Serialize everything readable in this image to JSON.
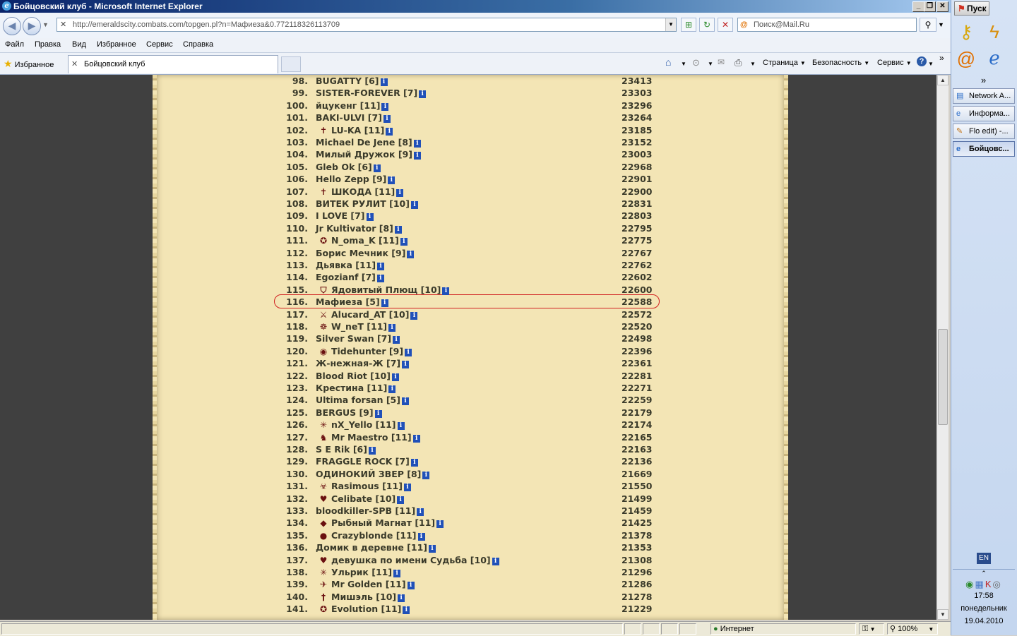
{
  "window": {
    "title": "Бойцовский клуб - Microsoft Internet Explorer",
    "controls": [
      "_",
      "❐",
      "✕"
    ]
  },
  "address_bar": {
    "url": "http://emeraldscity.combats.com/topgen.pl?n=Мафиеза&0.772118326113709"
  },
  "search": {
    "placeholder": "Поиск@Mail.Ru"
  },
  "menu": [
    "Файл",
    "Правка",
    "Вид",
    "Избранное",
    "Сервис",
    "Справка"
  ],
  "favorites_bar": {
    "favorites_label": "Избранное",
    "tab_title": "Бойцовский клуб"
  },
  "command_bar": {
    "page": "Страница",
    "safety": "Безопасность",
    "tools": "Сервис"
  },
  "ranking": [
    {
      "rank": "98.",
      "name": "BUGATTY [6]",
      "score": "23413",
      "emblem": ""
    },
    {
      "rank": "99.",
      "name": "SISTER-FOREVER [7]",
      "score": "23303",
      "emblem": ""
    },
    {
      "rank": "100.",
      "name": "йцукенг [11]",
      "score": "23296",
      "emblem": ""
    },
    {
      "rank": "101.",
      "name": "BAKI-ULVI [7]",
      "score": "23264",
      "emblem": ""
    },
    {
      "rank": "102.",
      "name": "LU-KA [11]",
      "score": "23185",
      "emblem": "✝"
    },
    {
      "rank": "103.",
      "name": "Michael De Jene [8]",
      "score": "23152",
      "emblem": ""
    },
    {
      "rank": "104.",
      "name": "Милый Дружок [9]",
      "score": "23003",
      "emblem": ""
    },
    {
      "rank": "105.",
      "name": "Gleb Ok [6]",
      "score": "22968",
      "emblem": ""
    },
    {
      "rank": "106.",
      "name": "Hello Zepp [9]",
      "score": "22901",
      "emblem": ""
    },
    {
      "rank": "107.",
      "name": "ШКОДА [11]",
      "score": "22900",
      "emblem": "✝"
    },
    {
      "rank": "108.",
      "name": "ВИТЕК РУЛИТ [10]",
      "score": "22831",
      "emblem": ""
    },
    {
      "rank": "109.",
      "name": "I LOVE [7]",
      "score": "22803",
      "emblem": ""
    },
    {
      "rank": "110.",
      "name": "Jr Kultivator [8]",
      "score": "22795",
      "emblem": ""
    },
    {
      "rank": "111.",
      "name": "N_oma_K [11]",
      "score": "22775",
      "emblem": "✪"
    },
    {
      "rank": "112.",
      "name": "Борис Мечник [9]",
      "score": "22767",
      "emblem": ""
    },
    {
      "rank": "113.",
      "name": "Дьявка [11]",
      "score": "22762",
      "emblem": ""
    },
    {
      "rank": "114.",
      "name": "Egozianf [7]",
      "score": "22602",
      "emblem": ""
    },
    {
      "rank": "115.",
      "name": "Ядовитый Плющ [10]",
      "score": "22600",
      "emblem": "⛉"
    },
    {
      "rank": "116.",
      "name": "Мафиеза [5]",
      "score": "22588",
      "emblem": ""
    },
    {
      "rank": "117.",
      "name": "Alucard_AT [10]",
      "score": "22572",
      "emblem": "⚔"
    },
    {
      "rank": "118.",
      "name": "W_neT [11]",
      "score": "22520",
      "emblem": "☸"
    },
    {
      "rank": "119.",
      "name": "Silver Swan [7]",
      "score": "22498",
      "emblem": ""
    },
    {
      "rank": "120.",
      "name": "Tidehunter [9]",
      "score": "22396",
      "emblem": "◉"
    },
    {
      "rank": "121.",
      "name": "Ж-нежная-Ж [7]",
      "score": "22361",
      "emblem": ""
    },
    {
      "rank": "122.",
      "name": "Blood Riot [10]",
      "score": "22281",
      "emblem": ""
    },
    {
      "rank": "123.",
      "name": "Крестина [11]",
      "score": "22271",
      "emblem": ""
    },
    {
      "rank": "124.",
      "name": "Ultima forsan [5]",
      "score": "22259",
      "emblem": ""
    },
    {
      "rank": "125.",
      "name": "BERGUS [9]",
      "score": "22179",
      "emblem": ""
    },
    {
      "rank": "126.",
      "name": "nX_Yello [11]",
      "score": "22174",
      "emblem": "✳"
    },
    {
      "rank": "127.",
      "name": "Mr Maestro [11]",
      "score": "22165",
      "emblem": "♞"
    },
    {
      "rank": "128.",
      "name": "S E Rik [6]",
      "score": "22163",
      "emblem": ""
    },
    {
      "rank": "129.",
      "name": "FRAGGLE ROCK [7]",
      "score": "22136",
      "emblem": ""
    },
    {
      "rank": "130.",
      "name": "ОДИНОКИЙ ЗВЕР [8]",
      "score": "21669",
      "emblem": ""
    },
    {
      "rank": "131.",
      "name": "Rasimous [11]",
      "score": "21550",
      "emblem": "☣"
    },
    {
      "rank": "132.",
      "name": "Celibate [10]",
      "score": "21499",
      "emblem": "♥"
    },
    {
      "rank": "133.",
      "name": "bloodkiller-SPB [11]",
      "score": "21459",
      "emblem": ""
    },
    {
      "rank": "134.",
      "name": "Рыбный Магнат [11]",
      "score": "21425",
      "emblem": "◆"
    },
    {
      "rank": "135.",
      "name": "Crazyblonde [11]",
      "score": "21378",
      "emblem": "●"
    },
    {
      "rank": "136.",
      "name": "Домик в деревне [11]",
      "score": "21353",
      "emblem": ""
    },
    {
      "rank": "137.",
      "name": "девушка по имени Судьба [10]",
      "score": "21308",
      "emblem": "♥"
    },
    {
      "rank": "138.",
      "name": "Ульрик [11]",
      "score": "21296",
      "emblem": "✳"
    },
    {
      "rank": "139.",
      "name": "Mr Golden [11]",
      "score": "21286",
      "emblem": "✈"
    },
    {
      "rank": "140.",
      "name": "Мишэль [10]",
      "score": "21278",
      "emblem": "†"
    },
    {
      "rank": "141.",
      "name": "Evolution [11]",
      "score": "21229",
      "emblem": "✪"
    }
  ],
  "highlighted_rank": "116.",
  "status_bar": {
    "zone": "Интернет",
    "zoom": "100%"
  },
  "taskbar": {
    "start": "Пуск",
    "tasks": [
      {
        "label": "Network A...",
        "active": false
      },
      {
        "label": "Информа...",
        "active": false
      },
      {
        "label": "Flo edit) -...",
        "active": false
      },
      {
        "label": "Бойцовс...",
        "active": true
      }
    ],
    "lang": "EN",
    "time": "17:58",
    "weekday": "понедельник",
    "date": "19.04.2010"
  },
  "colors": {
    "parchment": "#f3e5b5",
    "highlight_border": "#d02020",
    "info_icon": "#2050b8"
  }
}
